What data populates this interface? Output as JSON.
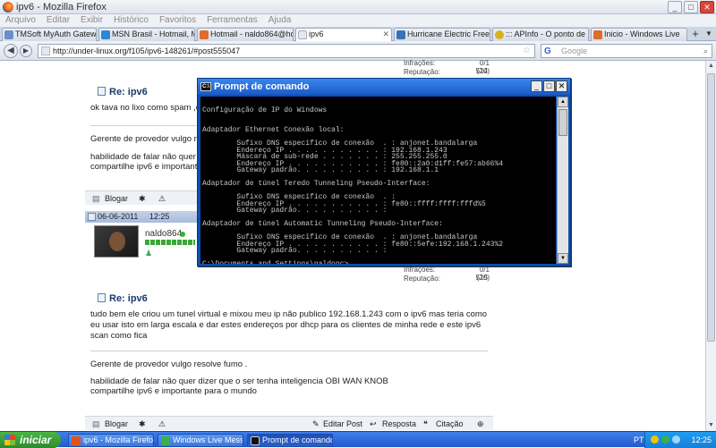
{
  "browser": {
    "title": "ipv6 - Mozilla Firefox",
    "menu": [
      "Arquivo",
      "Editar",
      "Exibir",
      "Histórico",
      "Favoritos",
      "Ferramentas",
      "Ajuda"
    ],
    "tabs": [
      {
        "label": "TMSoft MyAuth Gateway 3",
        "color": "#6a8fc7"
      },
      {
        "label": "MSN Brasil - Hotmail, Mes...",
        "color": "#2f86d9"
      },
      {
        "label": "Hotmail - naldo864@hotm...",
        "color": "#e06b2b"
      },
      {
        "label": "ipv6",
        "color": "#e5e8ee"
      },
      {
        "label": "Hurricane Electric Free IP...",
        "color": "#3773b8"
      },
      {
        "label": "::: APInfo - O ponto de ...",
        "color": "#d6b31d"
      },
      {
        "label": "Inicio - Windows Live",
        "color": "#e06b2b"
      }
    ],
    "url": "http://under-linux.org/f105/ipv6-148261/#post555047",
    "search_placeholder": "Google"
  },
  "forum": {
    "post1": {
      "infracoes_label": "Infrações:",
      "infracoes_value": "0/1 (20)",
      "reputacao_label": "Reputação:",
      "reputacao_value": "514",
      "title": "Re: ipv6",
      "line1": "ok tava no lixo como spam ,c",
      "line2": "Gerente de provedor vulgo re",
      "line3": "habilidade de falar não quer",
      "line4": "compartilhe ipv6 e important"
    },
    "actions1": {
      "blog": "Blogar"
    },
    "post2": {
      "date": "06-06-2011",
      "time": "12:25",
      "username": "naldo864",
      "infracoes_label": "Infrações:",
      "infracoes_value": "0/1 (20)",
      "reputacao_label": "Reputação:",
      "reputacao_value": "515",
      "title": "Re: ipv6",
      "body1": "tudo bem ele criou um tunel virtual e mixou meu ip não publico 192.168.1.243 com o ipv6 mas teria como",
      "body2": "eu usar isto em larga escala e dar estes endereços por dhcp para os clientes de minha rede e este ipv6",
      "body3": "scan como fica",
      "sig1": "Gerente de provedor vulgo resolve fumo .",
      "sig2": "habilidade de falar não quer dizer que o ser tenha inteligencia OBI WAN KNOB",
      "sig3": "compartilhe ipv6 e importante para o mundo"
    },
    "actions2": {
      "blog": "Blogar",
      "edit": "Editar Post",
      "reply": "Resposta",
      "quote": "Citação"
    }
  },
  "cmd": {
    "title": "Prompt de comando",
    "lines": [
      "",
      "Configuração de IP do Windows",
      "",
      "",
      "Adaptador Ethernet Conexão local:",
      "",
      "        Sufixo DNS específico de conexão  . : anjonet.bandalarga",
      "        Endereço IP . . . . . . . . . . . : 192.168.1.243",
      "        Máscara de sub-rede . . . . . . . : 255.255.255.0",
      "        Endereço IP . . . . . . . . . . . : fe80::2a0:d1ff:fe57:ab66%4",
      "        Gateway padrão. . . . . . . . . . : 192.168.1.1",
      "",
      "Adaptador de túnel Teredo Tunneling Pseudo-Interface:",
      "",
      "        Sufixo DNS específico de conexão  . :",
      "        Endereço IP . . . . . . . . . . . : fe80::ffff:ffff:fffd%5",
      "        Gateway padrão. . . . . . . . . . :",
      "",
      "Adaptador de túnel Automatic Tunneling Pseudo-Interface:",
      "",
      "        Sufixo DNS específico de conexão  . : anjonet.bandalarga",
      "        Endereço IP . . . . . . . . . . . : fe80::5efe:192.168.1.243%2",
      "        Gateway padrão. . . . . . . . . . :",
      "",
      "C:\\Documents and Settings\\naldopc>_"
    ]
  },
  "taskbar": {
    "start": "iniciar",
    "tasks": [
      {
        "label": "ipv6 - Mozilla Firefox",
        "color": "#e0541c"
      },
      {
        "label": "Windows Live Messen...",
        "color": "#3ab04a"
      },
      {
        "label": "Prompt de comando",
        "color": "#111111"
      }
    ],
    "lang": "PT",
    "clock": "12:25"
  }
}
